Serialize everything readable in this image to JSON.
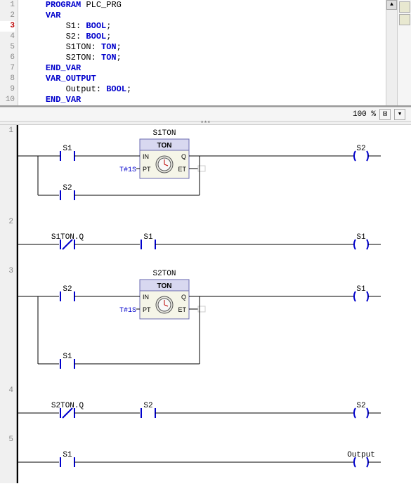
{
  "code": {
    "lines": [
      {
        "n": "1",
        "indent": "    ",
        "tokens": [
          {
            "t": "PROGRAM",
            "c": "kw"
          },
          {
            "t": " ",
            "c": ""
          },
          {
            "t": "PLC_PRG",
            "c": "id"
          }
        ]
      },
      {
        "n": "2",
        "indent": "    ",
        "tokens": [
          {
            "t": "VAR",
            "c": "kw"
          }
        ]
      },
      {
        "n": "3",
        "indent": "        ",
        "tokens": [
          {
            "t": "S1",
            "c": "id"
          },
          {
            "t": ": ",
            "c": ""
          },
          {
            "t": "BOOL",
            "c": "ty"
          },
          {
            "t": ";",
            "c": ""
          }
        ],
        "cur": true
      },
      {
        "n": "4",
        "indent": "        ",
        "tokens": [
          {
            "t": "S2",
            "c": "id"
          },
          {
            "t": ": ",
            "c": ""
          },
          {
            "t": "BOOL",
            "c": "ty"
          },
          {
            "t": ";",
            "c": ""
          }
        ]
      },
      {
        "n": "5",
        "indent": "        ",
        "tokens": [
          {
            "t": "S1TON",
            "c": "id"
          },
          {
            "t": ": ",
            "c": ""
          },
          {
            "t": "TON",
            "c": "ty"
          },
          {
            "t": ";",
            "c": ""
          }
        ]
      },
      {
        "n": "6",
        "indent": "        ",
        "tokens": [
          {
            "t": "S2TON",
            "c": "id"
          },
          {
            "t": ": ",
            "c": ""
          },
          {
            "t": "TON",
            "c": "ty"
          },
          {
            "t": ";",
            "c": ""
          }
        ]
      },
      {
        "n": "7",
        "indent": "    ",
        "tokens": [
          {
            "t": "END_VAR",
            "c": "kw"
          }
        ]
      },
      {
        "n": "8",
        "indent": "    ",
        "tokens": [
          {
            "t": "VAR_OUTPUT",
            "c": "kw"
          }
        ]
      },
      {
        "n": "9",
        "indent": "        ",
        "tokens": [
          {
            "t": "Output",
            "c": "id"
          },
          {
            "t": ": ",
            "c": ""
          },
          {
            "t": "BOOL",
            "c": "ty"
          },
          {
            "t": ";",
            "c": ""
          }
        ]
      },
      {
        "n": "10",
        "indent": "    ",
        "tokens": [
          {
            "t": "END_VAR",
            "c": "kw"
          }
        ]
      }
    ]
  },
  "zoom": "100 %",
  "rungs": {
    "r1": {
      "c1": "S1",
      "c2": "S2",
      "inst": "S1TON",
      "type": "TON",
      "pt": "T#1S",
      "coil": "S2"
    },
    "r2": {
      "c1": "S1TON.Q",
      "c2": "S1",
      "coil": "S1"
    },
    "r3": {
      "c1": "S2",
      "c2": "S1",
      "inst": "S2TON",
      "type": "TON",
      "pt": "T#1S",
      "coil": "S1"
    },
    "r4": {
      "c1": "S2TON.Q",
      "c2": "S2",
      "coil": "S2"
    },
    "r5": {
      "c1": "S1",
      "coil": "Output"
    }
  },
  "pins": {
    "in": "IN",
    "pt": "PT",
    "q": "Q",
    "et": "ET"
  }
}
